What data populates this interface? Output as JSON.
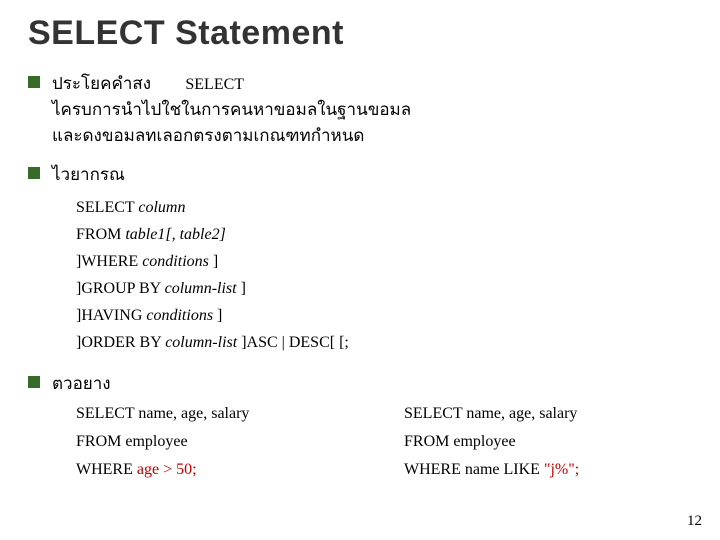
{
  "title": "SELECT Statement",
  "bullets": {
    "intro": {
      "line1_pre": "ประโยคคำสง",
      "keyword": "SELECT",
      "line2": "ไครบการนำไปใชในการคนหาขอมลในฐานขอมล",
      "line3": "และดงขอมลทเลอกตรงตามเกณฑทกำหนด"
    },
    "syntax_label": "ไวยากรณ",
    "syntax": {
      "l1_a": "SELECT ",
      "l1_b": "column",
      "l2_a": "FROM ",
      "l2_b": "table1[, table2]",
      "l3_a": "]WHERE ",
      "l3_b": "conditions",
      "l3_c": " ]",
      "l4_a": "]GROUP BY ",
      "l4_b": "column-list",
      "l4_c": " ]",
      "l5_a": "]HAVING ",
      "l5_b": "conditions",
      "l5_c": " ]",
      "l6_a": "]ORDER BY ",
      "l6_b": "column-list",
      "l6_c": "   ]ASC | DESC[ [;"
    },
    "example_label": "ตวอยาง"
  },
  "examples": {
    "left": {
      "l1": "SELECT name, age, salary",
      "l2": "FROM employee",
      "l3_a": "WHERE ",
      "l3_b": "age > 50;"
    },
    "right": {
      "l1": "SELECT name, age, salary",
      "l2": "FROM employee",
      "l3_a": "WHERE name LIKE ",
      "l3_b": "\"j%\";"
    }
  },
  "page_number": "12"
}
